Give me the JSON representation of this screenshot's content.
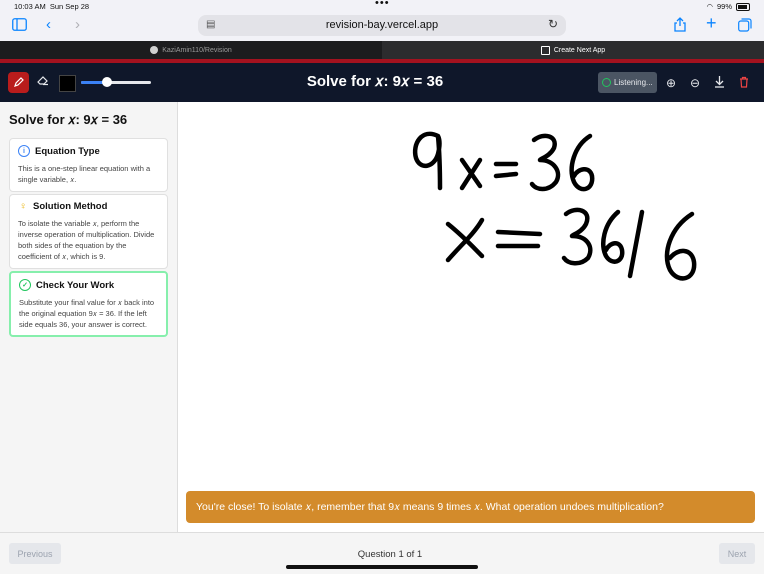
{
  "status": {
    "time": "10:03 AM",
    "date": "Sun Sep 28",
    "battery": "99%"
  },
  "browser": {
    "url": "revision-bay.vercel.app"
  },
  "tabs": [
    {
      "label": "KaziAmin110/Revision",
      "active": false
    },
    {
      "label": "Create Next App",
      "active": true
    }
  ],
  "header": {
    "title": "Solve for 𝑥: 9𝑥 = 36",
    "listening": "Listening..."
  },
  "sidebar": {
    "title": "Solve for 𝑥: 9𝑥 = 36",
    "cards": [
      {
        "heading": "Equation Type",
        "body": "This is a one-step linear equation with a single variable, 𝑥."
      },
      {
        "heading": "Solution Method",
        "body": "To isolate the variable 𝑥, perform the inverse operation of multiplication. Divide both sides of the equation by the coefficient of 𝑥, which is 9."
      },
      {
        "heading": "Check Your Work",
        "body": "Substitute your final value for 𝑥 back into the original equation 9𝑥 = 36. If the left side equals 36, your answer is correct."
      }
    ]
  },
  "feedback": "You're close! To isolate 𝑥, remember that 9𝑥 means 9 times 𝑥. What operation undoes multiplication?",
  "footer": {
    "previous": "Previous",
    "question": "Question 1 of 1",
    "next": "Next"
  },
  "colors": {
    "accent": "#b91c1c",
    "header_bg": "#0f172a",
    "feedback_bg": "#d38b2b"
  }
}
